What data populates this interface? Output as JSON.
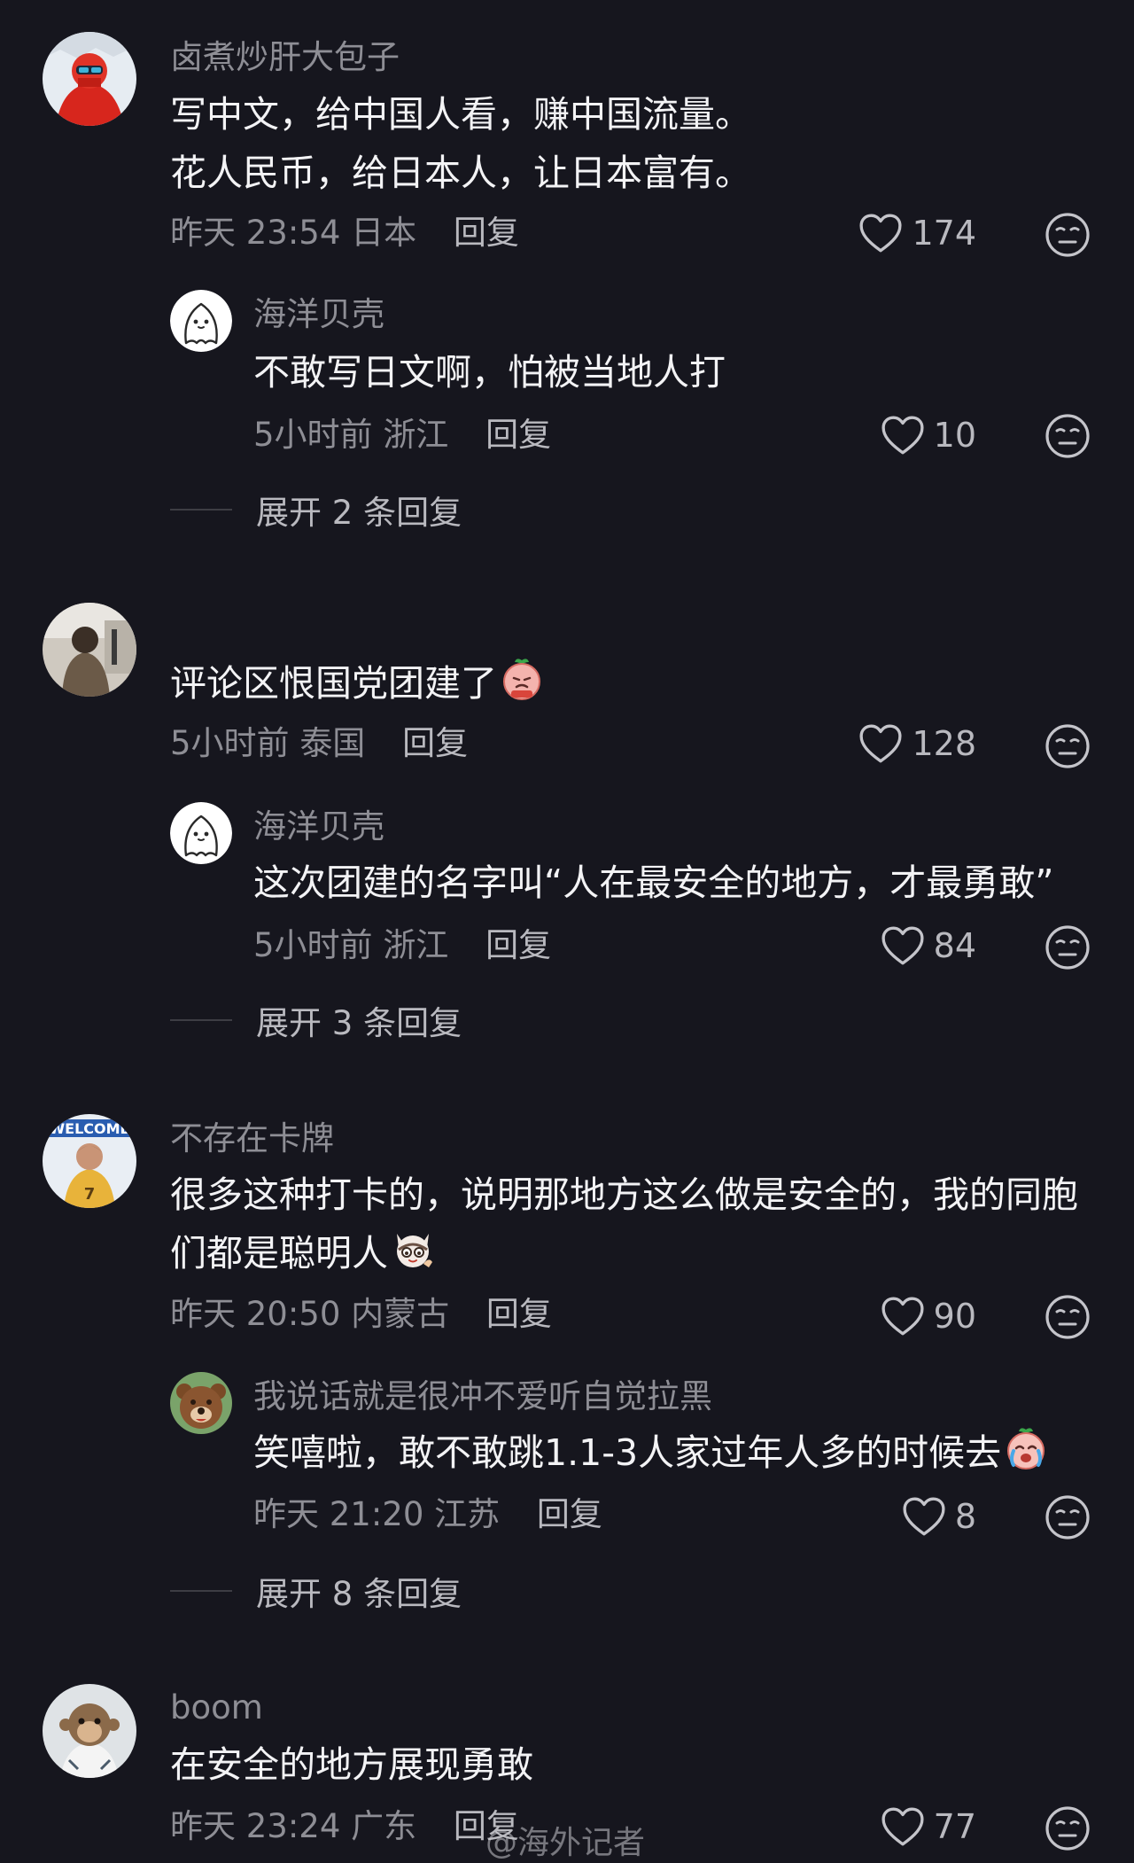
{
  "comments": [
    {
      "username": "卤煮炒肝大包子",
      "text_lines": [
        "写中文，给中国人看，赚中国流量。",
        "花人民币，给日本人，让日本富有。"
      ],
      "time": "昨天 23:54",
      "location": "日本",
      "reply_label": "回复",
      "likes": "174",
      "avatar_icon": "avatar-red-jacket",
      "replies": [
        {
          "username": "海洋贝壳",
          "text": "不敢写日文啊，怕被当地人打",
          "time": "5小时前",
          "location": "浙江",
          "reply_label": "回复",
          "likes": "10",
          "avatar_icon": "avatar-white-cartoon"
        }
      ],
      "expand_label": "展开 2 条回复"
    },
    {
      "username": "",
      "text_lines": [
        "评论区恨国党团建了"
      ],
      "text_emoji": "peach-tied-emoji",
      "time": "5小时前",
      "location": "泰国",
      "reply_label": "回复",
      "likes": "128",
      "avatar_icon": "avatar-photo-person",
      "replies": [
        {
          "username": "海洋贝壳",
          "text": "这次团建的名字叫“人在最安全的地方，才最勇敢”",
          "time": "5小时前",
          "location": "浙江",
          "reply_label": "回复",
          "likes": "84",
          "avatar_icon": "avatar-white-cartoon"
        }
      ],
      "expand_label": "展开 3 条回复"
    },
    {
      "username": "不存在卡牌",
      "text_lines": [
        "很多这种打卡的，说明那地方这么做是安全的，我的同胞",
        "们都是聪明人"
      ],
      "text_emoji": "cat-emoji",
      "time": "昨天 20:50",
      "location": "内蒙古",
      "reply_label": "回复",
      "likes": "90",
      "avatar_icon": "avatar-basketball-player",
      "replies": [
        {
          "username": "我说话就是很冲不爱听自觉拉黑",
          "text": "笑嘻啦，敢不敢跳1.1-3人家过年人多的时候去",
          "text_emoji": "crying-peach-emoji",
          "time": "昨天 21:20",
          "location": "江苏",
          "reply_label": "回复",
          "likes": "8",
          "avatar_icon": "avatar-bear-cartoon"
        }
      ],
      "expand_label": "展开 8 条回复"
    },
    {
      "username": "boom",
      "text_lines": [
        "在安全的地方展现勇敢"
      ],
      "time": "昨天 23:24",
      "location": "广东",
      "reply_label": "回复",
      "likes": "77",
      "avatar_icon": "avatar-monkey"
    }
  ],
  "watermark": "@海外记者",
  "colors": {
    "background": "#16161e",
    "text": "#f3f3f5",
    "secondary": "#8e8e95",
    "action": "#b9b9bf"
  }
}
